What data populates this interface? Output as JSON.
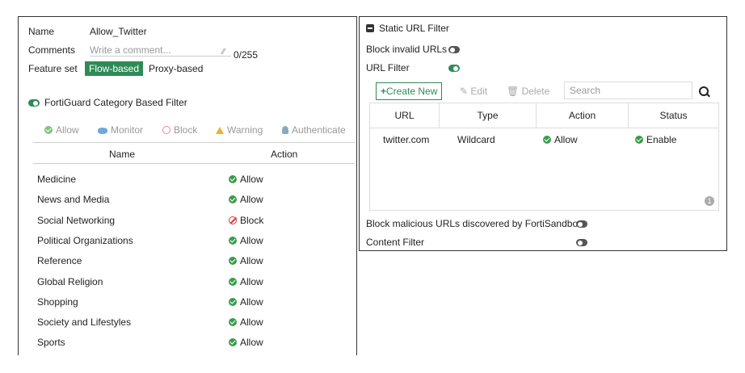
{
  "left": {
    "name_label": "Name",
    "name_value": "Allow_Twitter",
    "comments_label": "Comments",
    "comments_placeholder": "Write a comment...",
    "comments_count": "0/255",
    "feature_label": "Feature set",
    "feature_options": [
      "Flow-based",
      "Proxy-based"
    ],
    "feature_selected": "Flow-based",
    "fortiguard_label": "FortiGuard Category Based Filter",
    "fortiguard_enabled": true,
    "tabs": [
      "Allow",
      "Monitor",
      "Block",
      "Warning",
      "Authenticate"
    ],
    "columns": [
      "Name",
      "Action"
    ],
    "rows": [
      {
        "name": "Medicine",
        "action": "Allow"
      },
      {
        "name": "News and Media",
        "action": "Allow"
      },
      {
        "name": "Social Networking",
        "action": "Block"
      },
      {
        "name": "Political Organizations",
        "action": "Allow"
      },
      {
        "name": "Reference",
        "action": "Allow"
      },
      {
        "name": "Global Religion",
        "action": "Allow"
      },
      {
        "name": "Shopping",
        "action": "Allow"
      },
      {
        "name": "Society and Lifestyles",
        "action": "Allow"
      },
      {
        "name": "Sports",
        "action": "Allow"
      }
    ]
  },
  "right": {
    "section_title": "Static URL Filter",
    "block_invalid_label": "Block invalid URLs",
    "block_invalid_enabled": false,
    "url_filter_label": "URL Filter",
    "url_filter_enabled": true,
    "toolbar": {
      "create": "Create New",
      "edit": "Edit",
      "delete": "Delete",
      "search_placeholder": "Search"
    },
    "columns": [
      "URL",
      "Type",
      "Action",
      "Status"
    ],
    "rows": [
      {
        "url": "twitter.com",
        "type": "Wildcard",
        "action": "Allow",
        "status": "Enable"
      }
    ],
    "count": "1",
    "block_malicious_label": "Block malicious URLs discovered by FortiSandbox",
    "block_malicious_enabled": false,
    "content_filter_label": "Content Filter",
    "content_filter_enabled": false
  },
  "colors": {
    "accent_green": "#2e8b57",
    "allow_green": "#3a9c4b",
    "block_red": "#dd3333"
  }
}
